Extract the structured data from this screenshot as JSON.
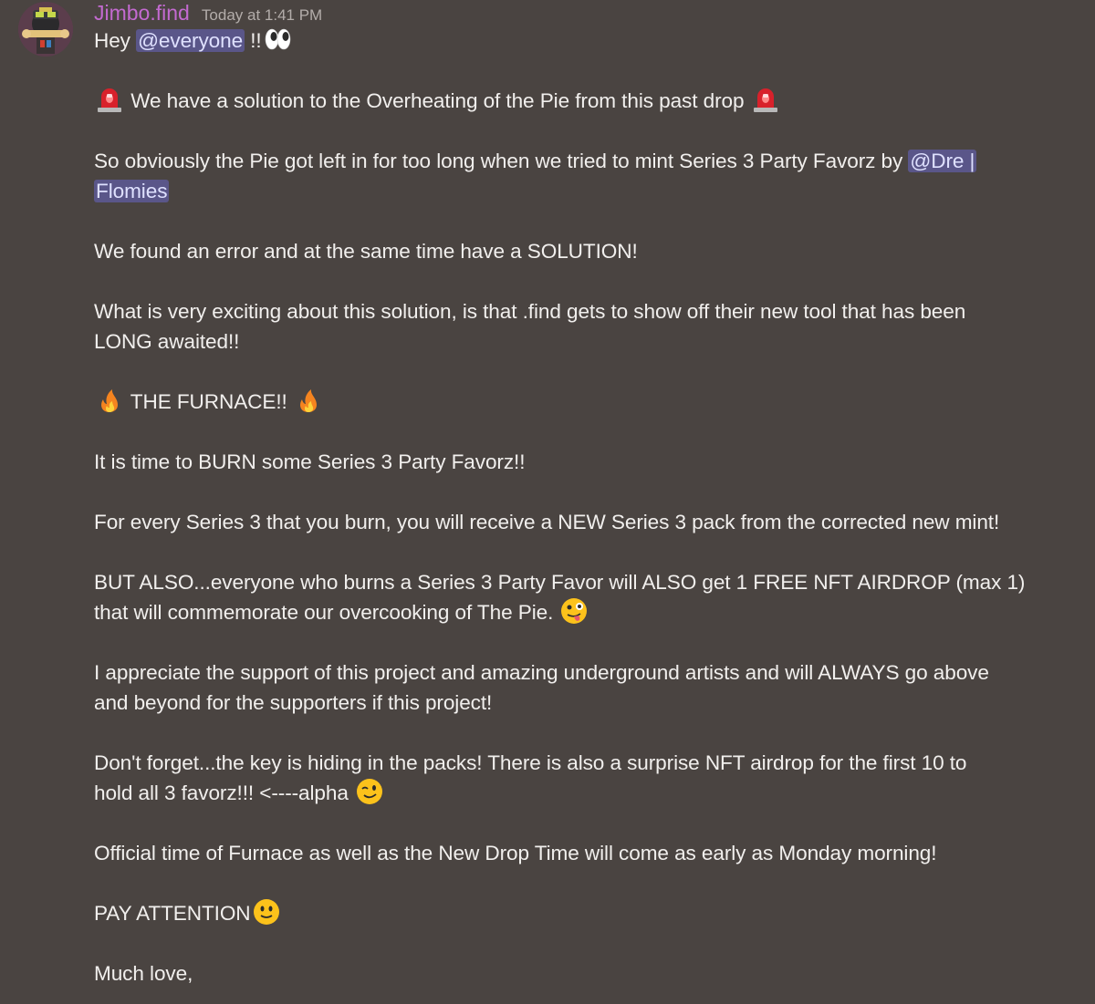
{
  "user": {
    "name": "Jimbo.find",
    "timestamp": "Today at 1:41 PM"
  },
  "colors": {
    "background": "#4a4441",
    "username": "#c36ad0",
    "mention_bg": "#5a5689",
    "mention_text": "#dfe1ff"
  },
  "message": {
    "greeting": "Hey",
    "mention_everyone": "@everyone",
    "greeting_suffix": "!!",
    "line_solution": "We have a solution to the Overheating of the Pie from this past drop",
    "line_pie_prefix": "So obviously the Pie got left in for too long when we tried to mint Series 3 Party Favorz by",
    "mention_dre_1": "@Dre |",
    "mention_dre_2": "Flomies",
    "line_error": "We found an error and at the same time have a SOLUTION!",
    "line_exciting_1": "What is very exciting about this solution, is that .find gets to show off their new tool that has been",
    "line_exciting_2": "LONG awaited!!",
    "line_furnace": "THE FURNACE!!",
    "line_burn": "It is time to BURN some Series 3 Party Favorz!!",
    "line_every": "For every Series 3 that you burn, you will receive a NEW Series 3 pack from the corrected new mint!",
    "line_but_1": "BUT ALSO...everyone who burns a Series 3 Party Favor will ALSO get 1 FREE NFT AIRDROP (max 1)",
    "line_but_2": "that will commemorate our overcooking of The Pie.",
    "line_appreciate_1": "I appreciate the support of this project and amazing underground artists and will ALWAYS go above",
    "line_appreciate_2": "and beyond for the supporters if this project!",
    "line_key_1": "Don't forget...the key is hiding in the packs! There is also a surprise NFT airdrop for the first 10 to",
    "line_key_2": "hold all 3 favorz!!! <----alpha",
    "line_official": "Official time of Furnace as well as the New Drop Time will come as early as Monday morning!",
    "line_pay": "PAY ATTENTION",
    "line_love": "Much love,"
  },
  "icons": [
    "avatar",
    "eyes-emoji",
    "rotating-light-emoji",
    "fire-emoji",
    "zany-face-emoji",
    "wink-emoji",
    "slight-smile-emoji"
  ]
}
